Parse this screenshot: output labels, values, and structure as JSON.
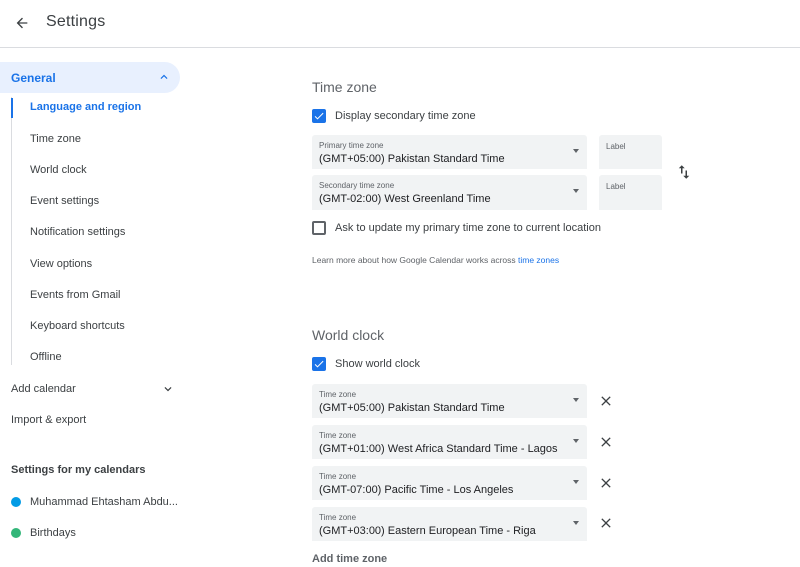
{
  "header": {
    "title": "Settings"
  },
  "sidebar": {
    "general_label": "General",
    "general_items": [
      "Language and region",
      "Time zone",
      "World clock",
      "Event settings",
      "Notification settings",
      "View options",
      "Events from Gmail",
      "Keyboard shortcuts",
      "Offline"
    ],
    "add_calendar": "Add calendar",
    "import_export": "Import & export",
    "my_calendars_heading": "Settings for my calendars",
    "calendars": [
      {
        "name": "Muhammad Ehtasham Abdu...",
        "color": "#039be5"
      },
      {
        "name": "Birthdays",
        "color": "#33b679"
      }
    ]
  },
  "time_zone": {
    "title": "Time zone",
    "display_secondary": {
      "label": "Display secondary time zone",
      "checked": true
    },
    "primary": {
      "label": "Primary time zone",
      "value": "(GMT+05:00) Pakistan Standard Time",
      "label_field": "Label"
    },
    "secondary": {
      "label": "Secondary time zone",
      "value": "(GMT-02:00) West Greenland Time",
      "label_field": "Label"
    },
    "ask_update": {
      "label": "Ask to update my primary time zone to current location",
      "checked": false
    },
    "learn_more_text": "Learn more about how Google Calendar works across ",
    "learn_more_link": "time zones"
  },
  "world_clock": {
    "title": "World clock",
    "show": {
      "label": "Show world clock",
      "checked": true
    },
    "field_label": "Time zone",
    "zones": [
      "(GMT+05:00) Pakistan Standard Time",
      "(GMT+01:00) West Africa Standard Time - Lagos",
      "(GMT-07:00) Pacific Time - Los Angeles",
      "(GMT+03:00) Eastern European Time - Riga"
    ],
    "add_label": "Add time zone"
  },
  "colors": {
    "accent": "#1a73e8",
    "accent_bg": "#e8f0fe",
    "field_bg": "#f1f3f4"
  },
  "icons": {
    "back": "arrow-back-icon",
    "expand": "chevron-up-icon",
    "collapse": "chevron-down-icon",
    "swap": "swap-vertical-icon",
    "remove": "close-icon",
    "check": "check-icon"
  }
}
